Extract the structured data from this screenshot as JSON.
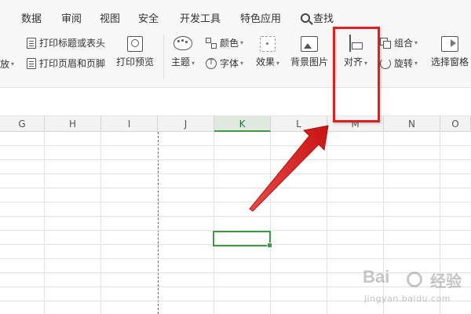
{
  "menu": {
    "items": [
      "数据",
      "审阅",
      "视图",
      "安全",
      "开发工具",
      "特色应用"
    ],
    "search_label": "查找"
  },
  "ribbon": {
    "partial_left_label": "放",
    "print_title_label": "打印标题或表头",
    "print_header_footer_label": "打印页眉和页脚",
    "print_preview_label": "打印预览",
    "theme_label": "主题",
    "color_label": "颜色",
    "font_label": "字体",
    "effect_label": "效果",
    "bg_image_label": "背景图片",
    "align_label": "对齐",
    "group_label": "组合",
    "rotate_label": "旋转",
    "selection_pane_label": "选择窗格"
  },
  "grid": {
    "columns": [
      "G",
      "H",
      "I",
      "J",
      "K",
      "L",
      "M",
      "N",
      "O"
    ],
    "active_column": "K"
  },
  "colors": {
    "accent_green": "#3d9a46",
    "annotation_red": "#e02020"
  },
  "watermark": {
    "main": "Bai",
    "sub": "经验",
    "url": "jingyan.baidu.com"
  }
}
